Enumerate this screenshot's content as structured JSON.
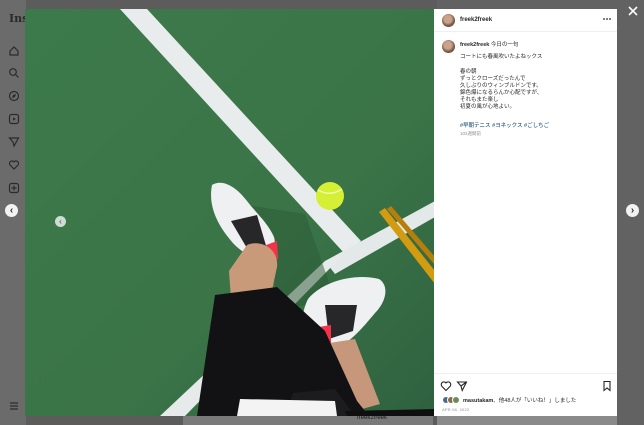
{
  "background": {
    "logo": "Inst",
    "feed_username": "freek2freek",
    "nav_icons": [
      "home-icon",
      "search-icon",
      "explore-icon",
      "reels-icon",
      "messages-icon",
      "heart-icon",
      "create-icon",
      "menu-icon"
    ]
  },
  "post": {
    "username": "freek2freek",
    "caption_title": "今日の一句",
    "caption_lines": [
      "コートにも春風吹いたよねックス",
      "",
      "春の朝",
      "ずっとクローズだったんで",
      "久しぶりのウィンブルドンです。",
      "錦色爆になるらんか心配ですが、",
      "それもまた楽し",
      "初夏の風が心地よい。"
    ],
    "hashtags": "#早朝テニス #ヨネックス #ごしちご",
    "posted_ago": "102週間前",
    "likes_user": "masutakam",
    "likes_suffix": "、他48人が「いいね！」しました",
    "date": "APR 08, 2022"
  },
  "carousel": {
    "current": 2,
    "total": 2
  },
  "colors": {
    "hashtag": "#00376b",
    "accent": "#3a8fe8",
    "court": "#3f7a4d"
  }
}
